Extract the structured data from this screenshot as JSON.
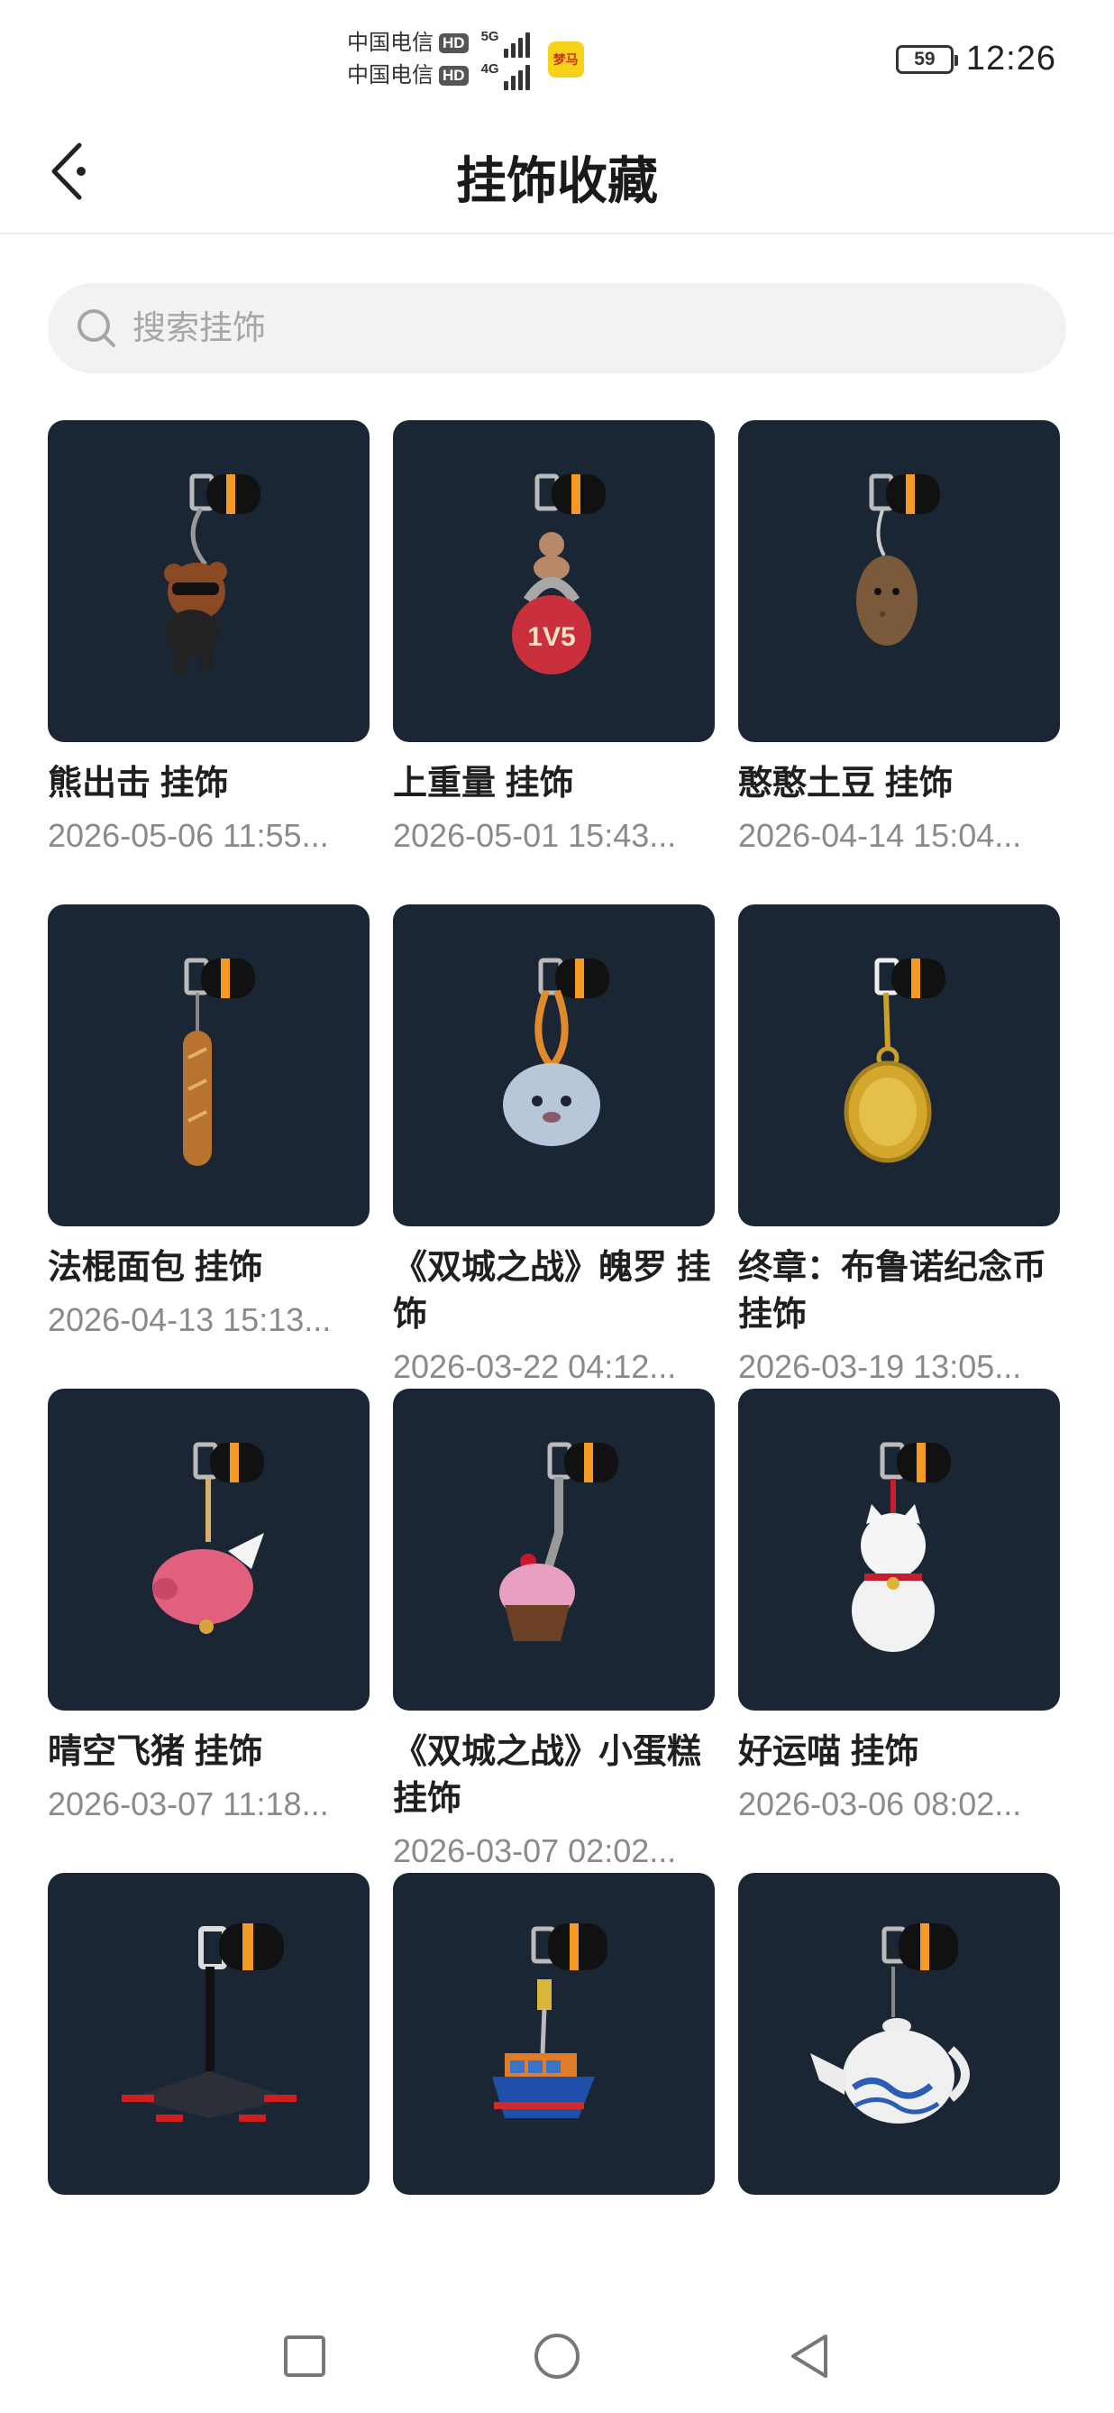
{
  "status_bar": {
    "carrier1": "中国电信",
    "carrier2": "中国电信",
    "hd": "HD",
    "net1": "5G",
    "net2": "4G",
    "app_badge": "梦马",
    "battery": "59",
    "time": "12:26"
  },
  "header": {
    "title": "挂饰收藏"
  },
  "search": {
    "placeholder": "搜索挂饰"
  },
  "items": [
    {
      "name": "熊出击 挂饰",
      "date": "2026-05-06 11:55...",
      "icon": "bear-charm-icon"
    },
    {
      "name": " 上重量 挂饰",
      "date": "2026-05-01 15:43...",
      "icon": "kettlebell-charm-icon",
      "badge": "1V5"
    },
    {
      "name": "憨憨土豆 挂饰",
      "date": "2026-04-14 15:04...",
      "icon": "potato-charm-icon"
    },
    {
      "name": "法棍面包 挂饰",
      "date": "2026-04-13 15:13...",
      "icon": "baguette-charm-icon"
    },
    {
      "name": "《双城之战》魄罗 挂饰",
      "date": "2026-03-22 04:12...",
      "icon": "poro-charm-icon"
    },
    {
      "name": "终章：布鲁诺纪念币 挂饰",
      "date": "2026-03-19 13:05...",
      "icon": "coin-charm-icon"
    },
    {
      "name": "晴空飞猪 挂饰",
      "date": "2026-03-07 11:18...",
      "icon": "flying-pig-charm-icon"
    },
    {
      "name": "《双城之战》小蛋糕 挂饰",
      "date": "2026-03-07 02:02...",
      "icon": "cupcake-charm-icon"
    },
    {
      "name": "好运喵 挂饰",
      "date": "2026-03-06 08:02...",
      "icon": "lucky-cat-charm-icon"
    },
    {
      "name": "",
      "date": "",
      "icon": "drone-charm-icon"
    },
    {
      "name": "",
      "date": "",
      "icon": "ship-charm-icon"
    },
    {
      "name": "",
      "date": "",
      "icon": "teapot-charm-icon"
    }
  ],
  "colors": {
    "card_background": "#1b2634",
    "accent_orange": "#f59a23",
    "date_gray": "#8a8a8a"
  }
}
